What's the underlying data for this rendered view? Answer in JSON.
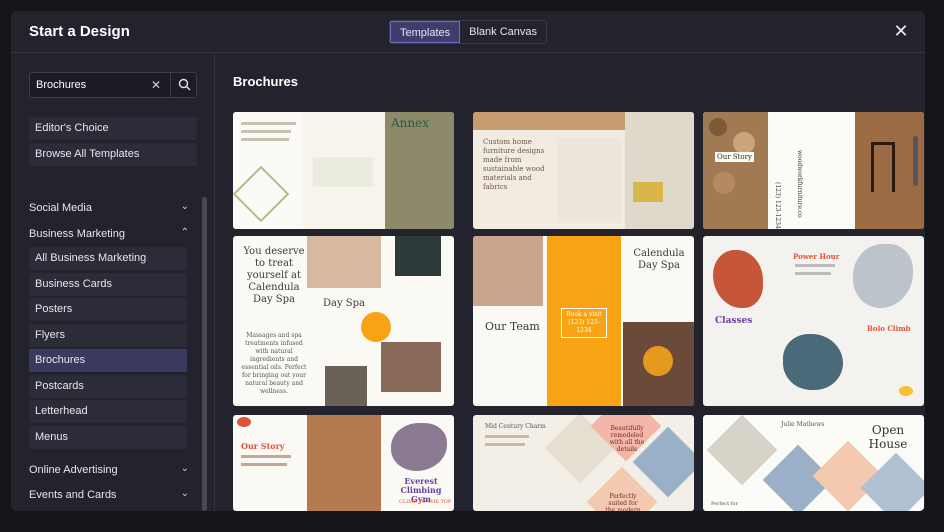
{
  "modal": {
    "title": "Start a Design",
    "close_icon": "close-icon"
  },
  "mode_tabs": [
    {
      "label": "Templates",
      "active": true
    },
    {
      "label": "Blank Canvas",
      "active": false
    }
  ],
  "search": {
    "value": "Brochures",
    "clear_icon": "close-icon",
    "search_icon": "search-icon"
  },
  "quick_links": [
    {
      "label": "Editor's Choice"
    },
    {
      "label": "Browse All Templates"
    }
  ],
  "categories": {
    "social_media": {
      "label": "Social Media",
      "expanded": false
    },
    "business_marketing": {
      "label": "Business Marketing",
      "expanded": true,
      "items": [
        {
          "label": "All Business Marketing",
          "selected": false
        },
        {
          "label": "Business Cards",
          "selected": false
        },
        {
          "label": "Posters",
          "selected": false
        },
        {
          "label": "Flyers",
          "selected": false
        },
        {
          "label": "Brochures",
          "selected": true
        },
        {
          "label": "Postcards",
          "selected": false
        },
        {
          "label": "Letterhead",
          "selected": false
        },
        {
          "label": "Menus",
          "selected": false
        }
      ]
    },
    "online_advertising": {
      "label": "Online Advertising",
      "expanded": false
    },
    "events_and_cards": {
      "label": "Events and Cards",
      "expanded": false
    }
  },
  "section": {
    "title": "Brochures"
  },
  "templates": [
    {
      "texts": {
        "t1": "Annex"
      }
    },
    {
      "texts": {
        "t1": "Custom home furniture designs made from sustainable wood materials and fabrics"
      }
    },
    {
      "texts": {
        "t1": "Our Story",
        "t2": "(123) 123-1234",
        "t3": "woodworkfurniture.co"
      }
    },
    {
      "texts": {
        "t1": "You deserve to treat yourself at Calendula Day Spa",
        "t2": "Day Spa",
        "t3": "Massages and spa treatments infused with natural ingredients and essential oils. Perfect for bringing out your natural beauty and wellness."
      }
    },
    {
      "texts": {
        "t1": "Our Team",
        "t2": "Calendula Day Spa",
        "t3": "Book a visit (123) 123-1234"
      }
    },
    {
      "texts": {
        "t1": "Power Hour",
        "t2": "Classes",
        "t3": "Bolo Climb"
      }
    },
    {
      "texts": {
        "t1": "Our Story",
        "t2": "Everest Climbing Gym",
        "t3": "CLIMB TO THE TOP"
      }
    },
    {
      "texts": {
        "t1": "Mid Century Charm",
        "t2": "Beautifully remodeled with all the details",
        "t3": "Perfectly suited for the modern family"
      }
    },
    {
      "texts": {
        "t1": "Julie Mathews",
        "t2": "Open House",
        "t3": "Perfect for"
      }
    }
  ],
  "colors": {
    "accent": "#6f6cc0",
    "selected_bg": "#3b3960",
    "spa_orange": "#f7a314",
    "brand_dark": "#23232d"
  }
}
